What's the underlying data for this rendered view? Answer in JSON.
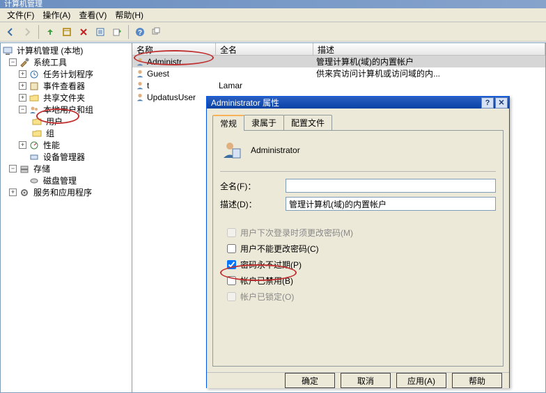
{
  "window": {
    "title": "计算机管理"
  },
  "menu": {
    "file": "文件(F)",
    "action": "操作(A)",
    "view": "查看(V)",
    "help": "帮助(H)"
  },
  "toolbar": {
    "back": "back",
    "forward": "forward",
    "up": "up",
    "show": "show",
    "delete": "delete",
    "refresh": "refresh",
    "export": "export",
    "help": "help",
    "window": "window"
  },
  "tree": {
    "root": "计算机管理 (本地)",
    "sys_tools": "系统工具",
    "task": "任务计划程序",
    "event": "事件查看器",
    "share": "共享文件夹",
    "local_users": "本地用户和组",
    "users": "用户",
    "groups": "组",
    "perf": "性能",
    "devmgr": "设备管理器",
    "storage": "存储",
    "diskmgr": "磁盘管理",
    "services": "服务和应用程序"
  },
  "list": {
    "cols": {
      "name": "名称",
      "full": "全名",
      "desc": "描述"
    },
    "rows": [
      {
        "name": "Administr...",
        "full": "",
        "desc": "管理计算机(域)的内置帐户"
      },
      {
        "name": "Guest",
        "full": "",
        "desc": "供来宾访问计算机或访问域的内..."
      },
      {
        "name": "t",
        "full": "Lamar",
        "desc": ""
      },
      {
        "name": "UpdatusUser",
        "full": "",
        "desc": ""
      }
    ]
  },
  "dialog": {
    "title": "Administrator 属性",
    "tabs": {
      "general": "常规",
      "member": "隶属于",
      "profile": "配置文件"
    },
    "username": "Administrator",
    "full_label": "全名(F)：",
    "full_value": "",
    "desc_label": "描述(D)：",
    "desc_value": "管理计算机(域)的内置帐户",
    "chk_mustchange": "用户下次登录时须更改密码(M)",
    "chk_cannotchange": "用户不能更改密码(C)",
    "chk_neverexpire": "密码永不过期(P)",
    "chk_disabled": "帐户已禁用(B)",
    "chk_locked": "帐户已锁定(O)",
    "btn_ok": "确定",
    "btn_cancel": "取消",
    "btn_apply": "应用(A)",
    "btn_help": "帮助"
  },
  "colors": {
    "accent": "#0054e3",
    "annot": "#c03030"
  }
}
